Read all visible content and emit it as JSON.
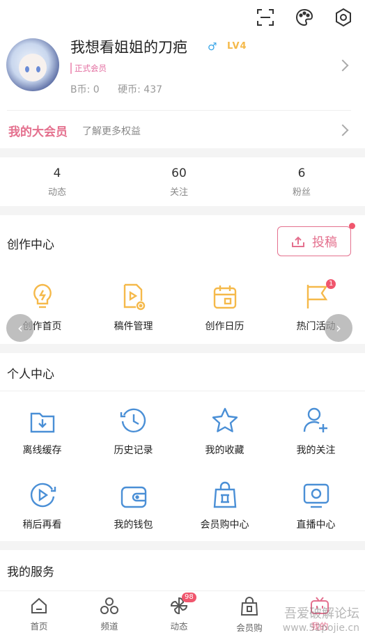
{
  "top_icons": [
    "scan-icon",
    "theme-palette-icon",
    "settings-gear-icon"
  ],
  "profile": {
    "username": "我想看姐姐的刀疤",
    "gender_symbol": "♂",
    "level": "LV4",
    "member_badge": "正式会员",
    "b_coin_label": "B币: 0",
    "coin_label": "硬币: 437"
  },
  "vip": {
    "title": "我的大会员",
    "subtitle": "了解更多权益"
  },
  "stats": [
    {
      "count": "4",
      "label": "动态"
    },
    {
      "count": "60",
      "label": "关注"
    },
    {
      "count": "6",
      "label": "粉丝"
    }
  ],
  "creation": {
    "title": "创作中心",
    "upload_label": "投稿",
    "items": [
      {
        "label": "创作首页",
        "icon": "lightbulb-icon"
      },
      {
        "label": "稿件管理",
        "icon": "video-file-icon"
      },
      {
        "label": "创作日历",
        "icon": "calendar-icon"
      },
      {
        "label": "热门活动",
        "icon": "flag-icon",
        "badge": "1"
      }
    ]
  },
  "personal": {
    "title": "个人中心",
    "items": [
      {
        "label": "离线缓存",
        "icon": "download-folder-icon"
      },
      {
        "label": "历史记录",
        "icon": "history-clock-icon"
      },
      {
        "label": "我的收藏",
        "icon": "star-icon"
      },
      {
        "label": "我的关注",
        "icon": "add-user-icon"
      },
      {
        "label": "稍后再看",
        "icon": "watch-later-icon"
      },
      {
        "label": "我的钱包",
        "icon": "wallet-icon"
      },
      {
        "label": "会员购中心",
        "icon": "shopping-bag-icon"
      },
      {
        "label": "直播中心",
        "icon": "live-tv-icon"
      }
    ]
  },
  "services": {
    "title": "我的服务"
  },
  "tabbar": [
    {
      "label": "首页",
      "icon": "home-icon"
    },
    {
      "label": "频道",
      "icon": "channel-icon"
    },
    {
      "label": "动态",
      "icon": "dynamic-pinwheel-icon",
      "badge": "98"
    },
    {
      "label": "会员购",
      "icon": "shopping-icon"
    },
    {
      "label": "我的",
      "icon": "tv-mine-icon",
      "active": true
    }
  ],
  "watermark": {
    "line1": "吾爱破解论坛",
    "line2": "www.52pojie.cn"
  },
  "colors": {
    "accent_pink": "#e4708e",
    "icon_orange": "#f5b94a",
    "icon_blue": "#4a8fd6",
    "badge_red": "#f0566d"
  }
}
